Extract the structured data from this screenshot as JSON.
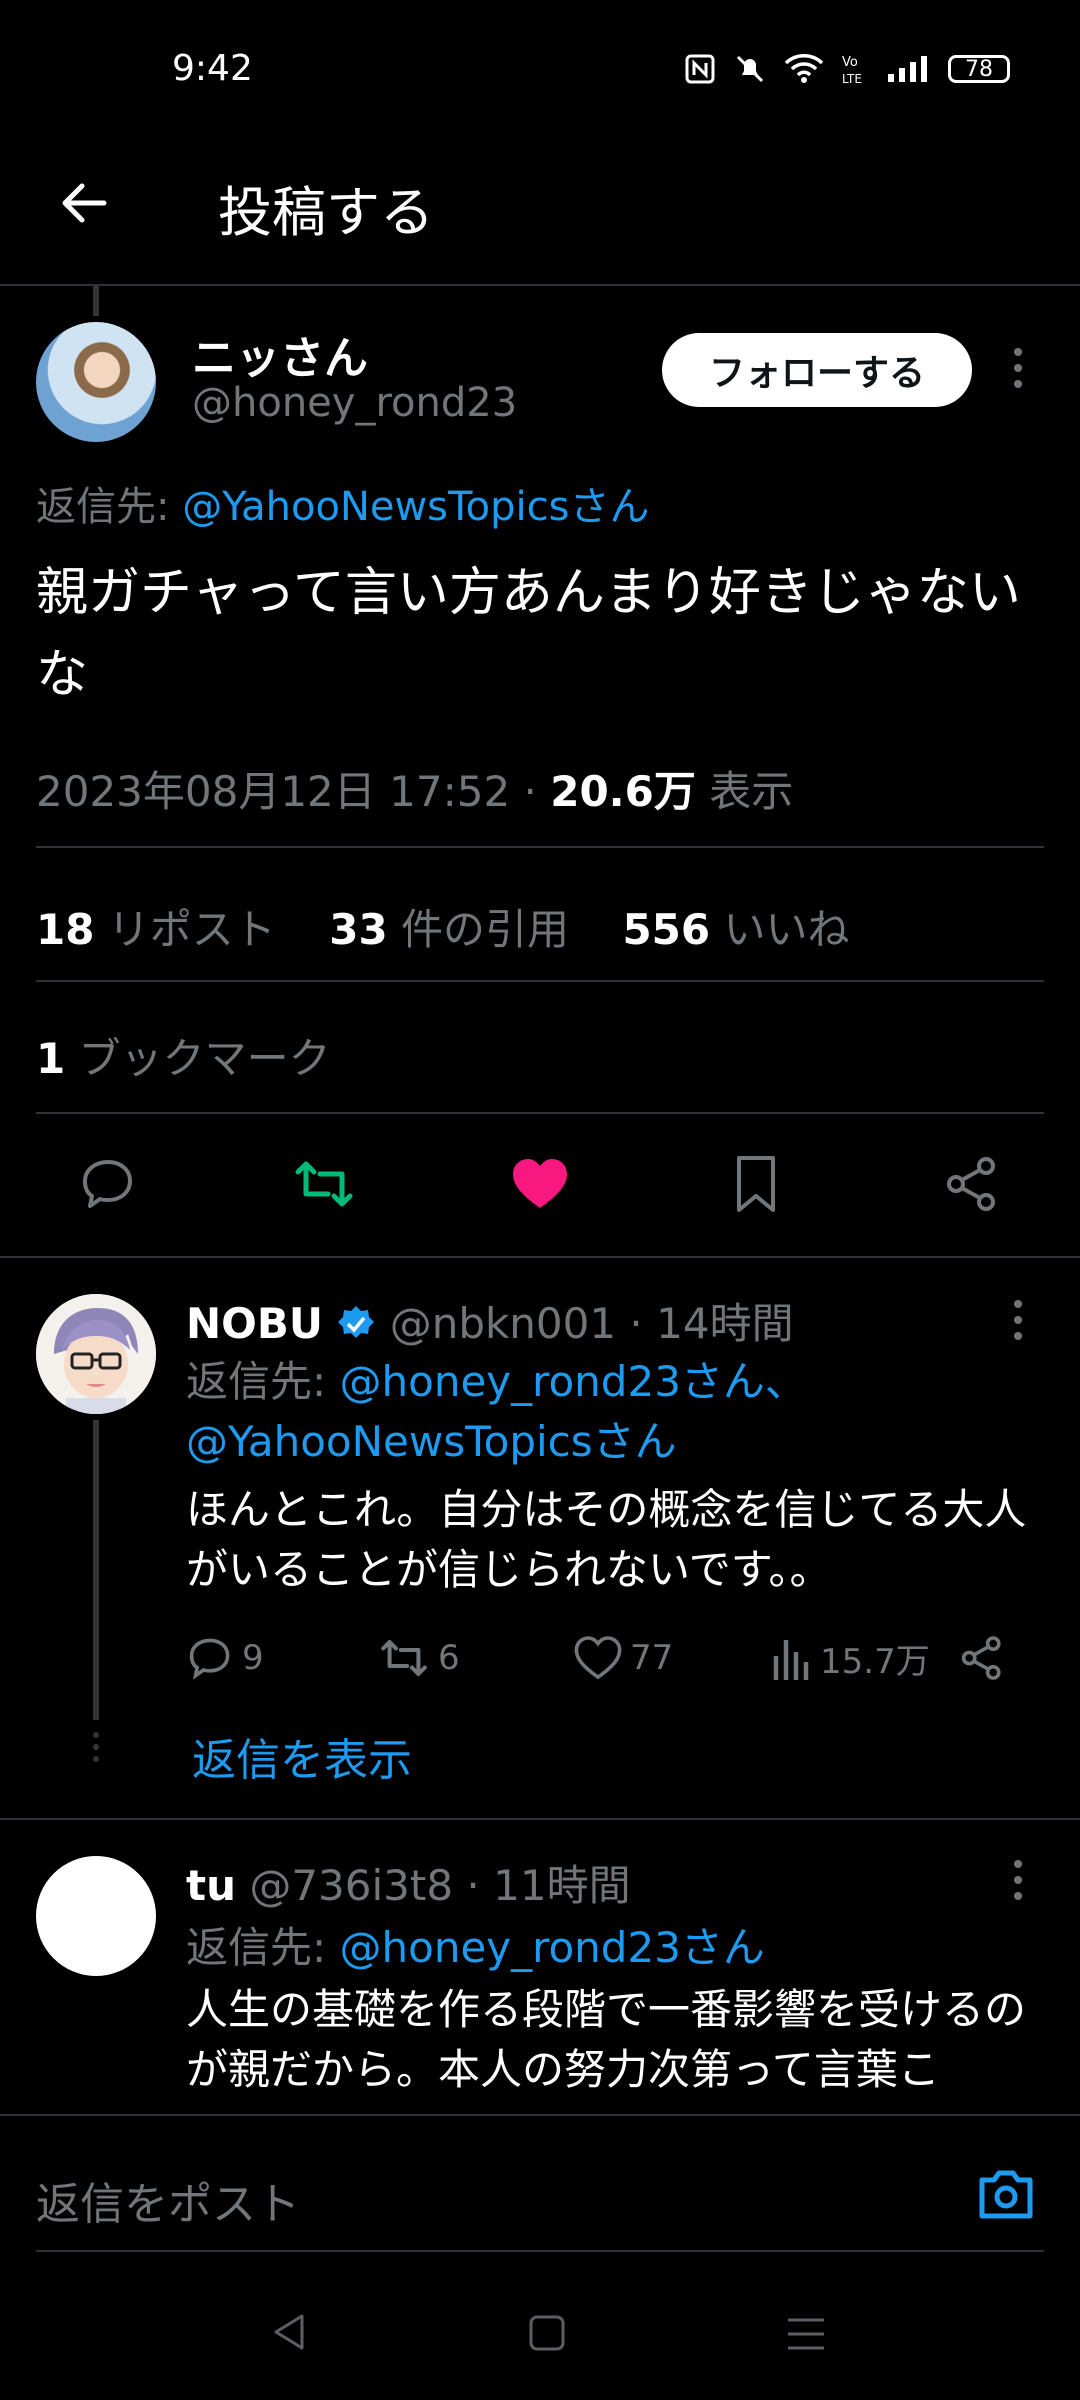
{
  "status_bar": {
    "time": "9:42",
    "battery": "78",
    "icons": [
      "nfc-icon",
      "mute-icon",
      "wifi-icon",
      "volte-icon",
      "signal-icon",
      "battery-icon"
    ]
  },
  "header": {
    "title": "投稿する"
  },
  "post": {
    "author_name": "ニッさん",
    "author_handle": "@honey_rond23",
    "follow_label": "フォローする",
    "reply_to_prefix": "返信先: ",
    "reply_to_handle": "@YahooNewsTopicsさん",
    "body": "親ガチャって言い方あんまり好きじゃないな",
    "datetime": "2023年08月12日 17:52 · ",
    "views_count": "20.6万",
    "views_label": " 表示",
    "reposts_count": "18",
    "reposts_label": " リポスト",
    "quotes_count": "33",
    "quotes_label": " 件の引用",
    "likes_count": "556",
    "likes_label": " いいね",
    "bookmarks_count": "1",
    "bookmarks_label": " ブックマーク",
    "like_color": "#f91880",
    "repost_color": "#00ba7c"
  },
  "replies": [
    {
      "name": "NOBU",
      "handle_time": " @nbkn001 · 14時間",
      "reply_to_prefix": "返信先: ",
      "reply_to_handles": "@honey_rond23さん、@YahooNewsTopicsさん",
      "body": "ほんとこれ。自分はその概念を信じてる大人がいることが信じられないです。。",
      "replies": "9",
      "reposts": "6",
      "likes": "77",
      "views": "15.7万",
      "show_replies": "返信を表示",
      "verified_color": "#1d9bf0"
    },
    {
      "name": "tu",
      "handle_time": " @736i3t8 · 11時間",
      "reply_to_prefix": "返信先: ",
      "reply_to_handles": "@honey_rond23さん",
      "body": "人生の基礎を作る段階で一番影響を受けるのが親だから。本人の努力次第って言葉こ"
    }
  ],
  "composer": {
    "placeholder": "返信をポスト"
  }
}
